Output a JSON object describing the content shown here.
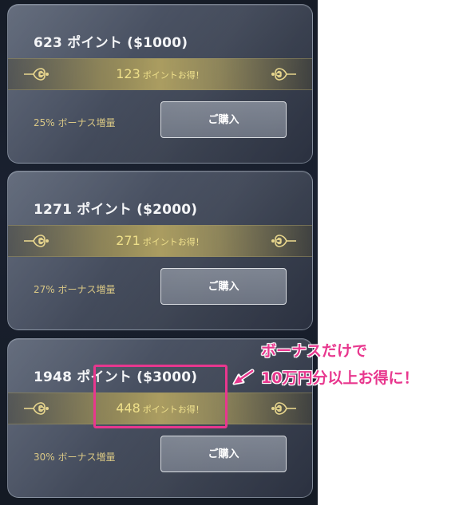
{
  "offers": [
    {
      "title": "623 ポイント ($1000)",
      "bonus_points": "123",
      "bonus_suffix": "ポイントお得！",
      "bonus_rate": "25% ボーナス増量",
      "buy_label": "ご購入"
    },
    {
      "title": "1271 ポイント ($2000)",
      "bonus_points": "271",
      "bonus_suffix": "ポイントお得！",
      "bonus_rate": "27% ボーナス増量",
      "buy_label": "ご購入"
    },
    {
      "title": "1948 ポイント ($3000)",
      "bonus_points": "448",
      "bonus_suffix": "ポイントお得！",
      "bonus_rate": "30% ボーナス増量",
      "buy_label": "ご購入"
    }
  ],
  "annotation": {
    "line1": "ボーナスだけで",
    "line2": "10万円分以上お得に！",
    "highlight_color": "#e8378e"
  },
  "icons": {
    "band_ornament": "flourish-ornament-icon",
    "annotation_arrow": "arrow-icon"
  }
}
